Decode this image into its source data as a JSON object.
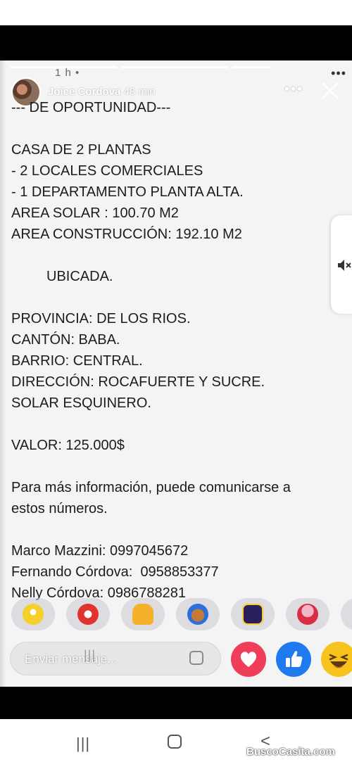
{
  "status": {
    "time_ghost": "1 h •"
  },
  "header": {
    "user_name": "Joice Cordova",
    "time_ago": "48 min",
    "more_glyph": "•••",
    "ghost_more_glyph": "•••"
  },
  "post": {
    "text_lines": [
      "--- DE OPORTUNIDAD---",
      "",
      "CASA DE 2 PLANTAS",
      "- 2 LOCALES COMERCIALES",
      "- 1 DEPARTAMENTO PLANTA ALTA.",
      "AREA SOLAR : 100.70 M2",
      "AREA CONSTRUCCIÓN: 192.10 M2",
      "",
      "         UBICADA.",
      "",
      "PROVINCIA: DE LOS RIOS.",
      "CANTÓN: BABA.",
      "BARRIO: CENTRAL.",
      "DIRECCIÓN: ROCAFUERTE Y SUCRE.",
      "SOLAR ESQUINERO.",
      "",
      "VALOR: 125.000$",
      "",
      "Para más información, puede comunicarse a",
      "estos números.",
      "",
      "Marco Mazzini: 0997045672",
      "Fernando Córdova:  0958853377",
      "Nelly Córdova: 0986788281"
    ]
  },
  "reactions": [
    "minion-sticker",
    "heart-hands-sticker",
    "thumbs-up-sticker",
    "dog-sticker",
    "u-up-sticker",
    "love-girl-sticker"
  ],
  "reply": {
    "placeholder": "Enviar mensaje...",
    "ghost_bars": "|||"
  },
  "quick_reactions": {
    "heart_color": "#f03e5a",
    "like_color": "#1f7af0",
    "haha_color": "#f7c31c"
  },
  "navbar": {
    "recents_glyph": "|||",
    "back_glyph": "<"
  },
  "watermark": "BuscoCasita.com"
}
